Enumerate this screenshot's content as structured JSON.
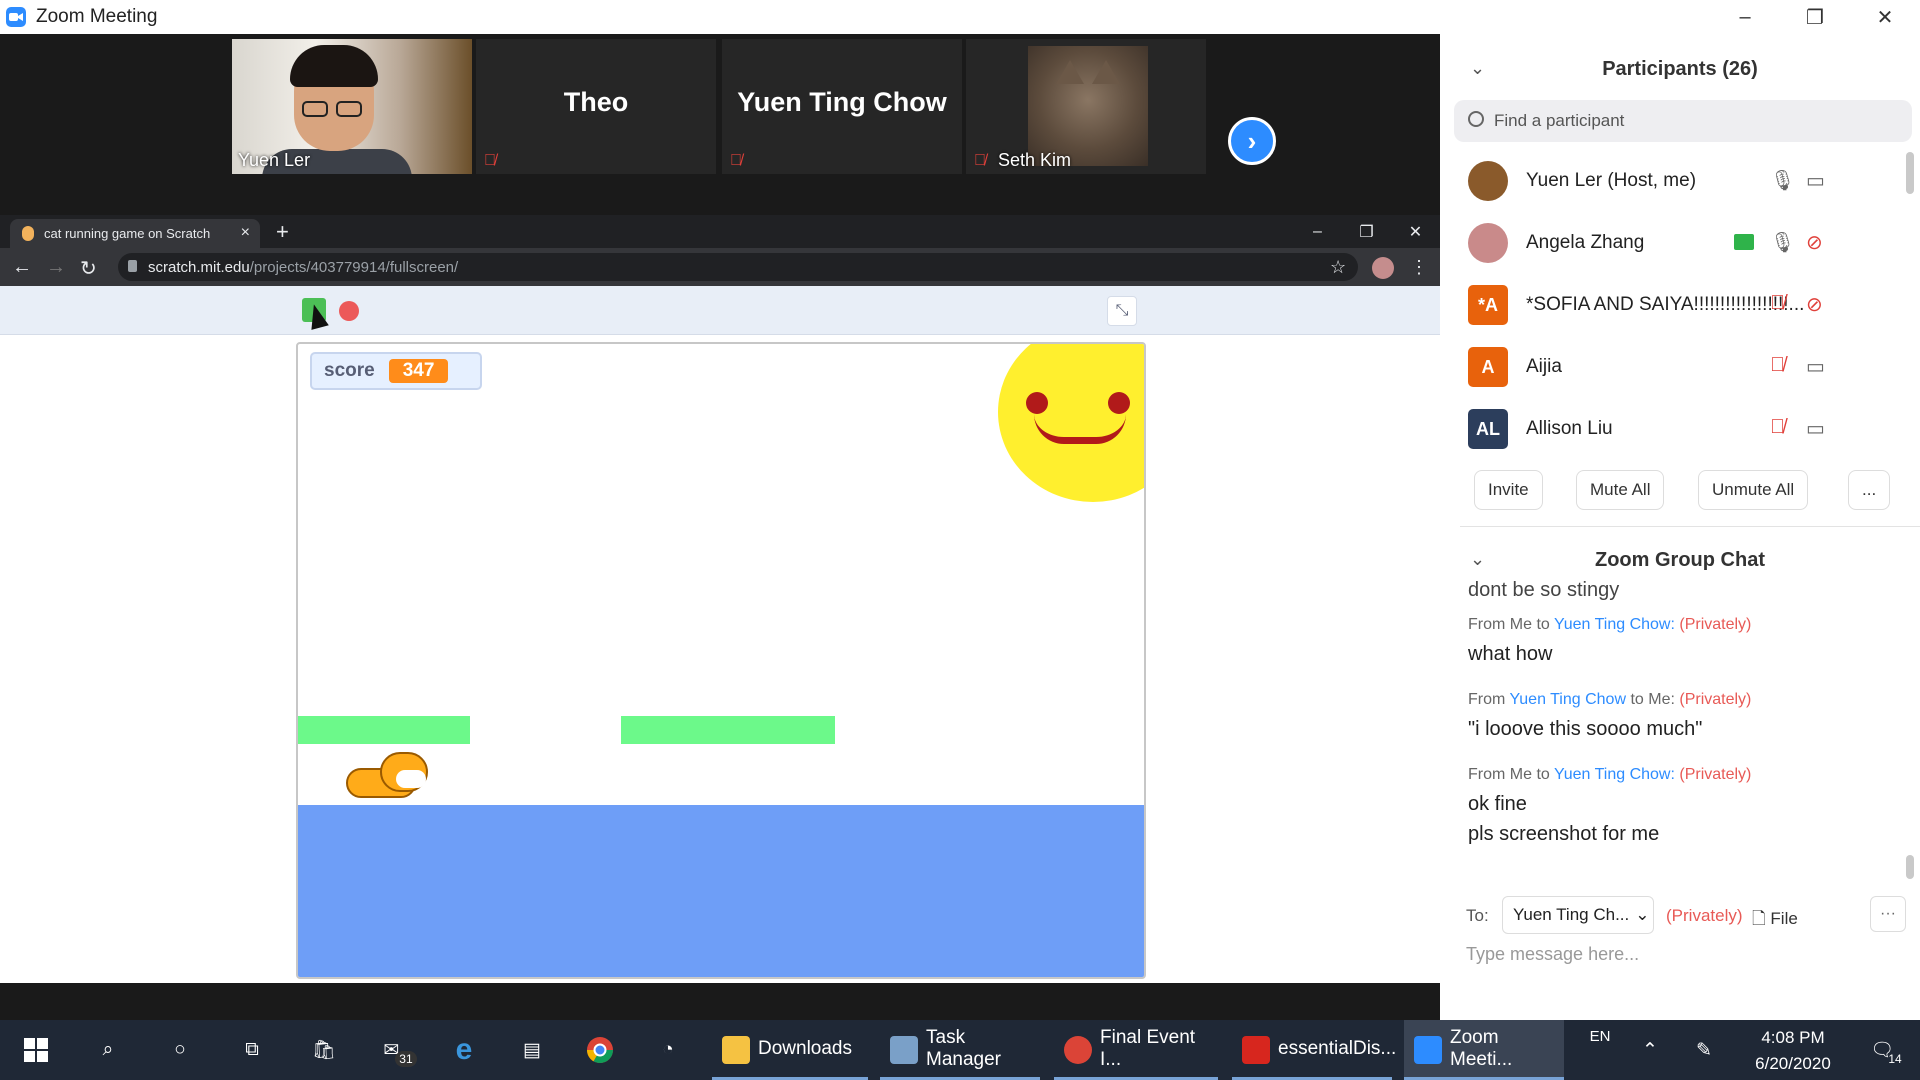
{
  "zoom": {
    "title": "Zoom Meeting",
    "win_min": "–",
    "win_restore": "❐",
    "win_close": "✕"
  },
  "video_tiles": [
    {
      "name": "Yuen Ler"
    },
    {
      "name": "Theo"
    },
    {
      "name": "Yuen Ting Chow"
    },
    {
      "name": "Seth Kim"
    }
  ],
  "browser": {
    "tab_title": "cat running game on Scratch",
    "tab_close": "×",
    "new_tab": "+",
    "url_host": "scratch.mit.edu",
    "url_path": "/projects/403779914/fullscreen/",
    "back": "←",
    "forward": "→",
    "reload": "↻",
    "star": "☆",
    "menu": "⋮",
    "win_min": "–",
    "win_restore": "❐",
    "win_close": "✕"
  },
  "scratch": {
    "score_label": "score",
    "score_value": "347",
    "shrink": "⤡"
  },
  "participants": {
    "header": "Participants (26)",
    "search_placeholder": "Find a participant",
    "list": [
      {
        "initials": "",
        "name": "Yuen Ler (Host, me)",
        "avatar_color": "#8a5a2b",
        "mic": "🎙",
        "cam": "📹",
        "mic_muted": false,
        "cam_off": false
      },
      {
        "initials": "",
        "name": "Angela Zhang",
        "avatar_color": "#c98a8a",
        "mic": "🎙",
        "cam": "⊘",
        "mic_muted": false,
        "cam_off": true,
        "sharing": true
      },
      {
        "initials": "*A",
        "name": "*SOFIA AND SAIYA!!!!!!!!!!!!!!!!!!...",
        "avatar_color": "#e8620c",
        "mic": "🎙",
        "cam": "⊘",
        "mic_muted": true,
        "cam_off": true
      },
      {
        "initials": "A",
        "name": "Aijia",
        "avatar_color": "#e8620c",
        "mic": "🎙",
        "cam": "📹",
        "mic_muted": true,
        "cam_off": false
      },
      {
        "initials": "AL",
        "name": "Allison Liu",
        "avatar_color": "#2c3e5c",
        "mic": "🎙",
        "cam": "📹",
        "mic_muted": true,
        "cam_off": false
      }
    ],
    "buttons": {
      "invite": "Invite",
      "mute_all": "Mute All",
      "unmute_all": "Unmute All",
      "more": "..."
    }
  },
  "chat": {
    "header": "Zoom Group Chat",
    "clipped_text": "dont be so stingy",
    "messages": [
      {
        "from": "From Me to ",
        "who": "Yuen Ting Chow:",
        "to": "",
        "priv": "(Privately)",
        "text": "what how"
      },
      {
        "from": "From ",
        "who": "Yuen Ting Chow",
        "to": " to Me:",
        "priv": "(Privately)",
        "text": "\"i looove this soooo much\""
      },
      {
        "from": "From Me to ",
        "who": "Yuen Ting Chow:",
        "to": "",
        "priv": "(Privately)",
        "text": "ok fine\npls screenshot for me"
      }
    ],
    "to_label": "To:",
    "to_select": "Yuen Ting Ch...",
    "privately": "(Privately)",
    "file_label": "File",
    "more": "···",
    "input_placeholder": "Type message here..."
  },
  "taskbar": {
    "badge_mail": "31",
    "apps": [
      {
        "label": "Downloads",
        "color": "#f5c242"
      },
      {
        "label": "Task Manager",
        "color": "#7aa0c8"
      },
      {
        "label": "Final Event I...",
        "color": "#db4437"
      },
      {
        "label": "essentialDis...",
        "color": "#d7261e"
      },
      {
        "label": "Zoom Meeti...",
        "color": "#2d8cff"
      }
    ],
    "lang": "EN",
    "time": "4:08 PM",
    "date": "6/20/2020",
    "notif_count": "14"
  }
}
